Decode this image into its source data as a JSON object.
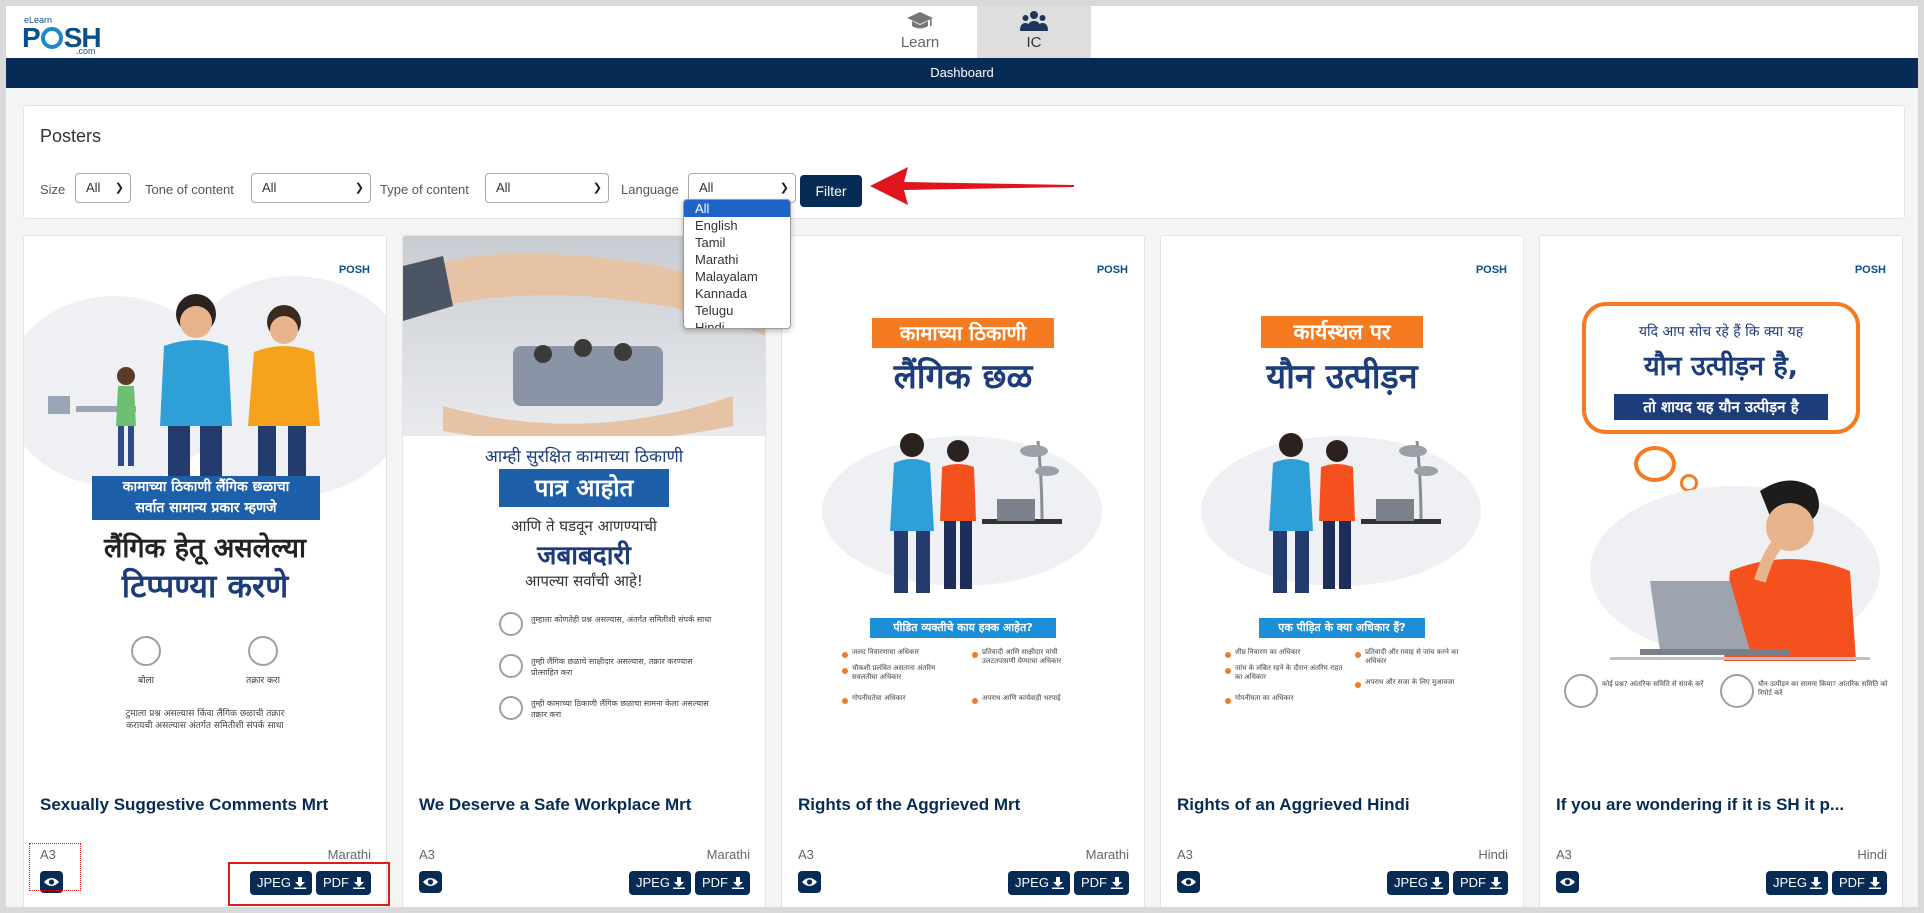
{
  "header": {
    "logo_small": "eLearn",
    "logo_big_a": "P",
    "logo_big_b": "SH",
    "logo_com": ".com",
    "tabs": [
      {
        "label": "Learn",
        "icon": "graduation-cap-icon"
      },
      {
        "label": "IC",
        "icon": "users-icon"
      }
    ],
    "nav_title": "Dashboard"
  },
  "filters": {
    "section_title": "Posters",
    "size_label": "Size",
    "size_value": "All",
    "tone_label": "Tone of content",
    "tone_value": "All",
    "type_label": "Type of content",
    "type_value": "All",
    "language_label": "Language",
    "language_value": "All",
    "filter_button": "Filter",
    "language_options": [
      "All",
      "English",
      "Tamil",
      "Marathi",
      "Malayalam",
      "Kannada",
      "Telugu",
      "Hindi"
    ]
  },
  "cards": [
    {
      "title": "Sexually Suggestive Comments Mrt",
      "size": "A3",
      "language": "Marathi",
      "jpeg_label": "JPEG",
      "pdf_label": "PDF",
      "poster": {
        "logo": "POSH",
        "box_line1": "कामाच्या ठिकाणी लैंगिक छळाचा",
        "box_line2": "सर्वात सामान्य प्रकार म्हणजे",
        "big1": "लैंगिक हेतू असलेल्या",
        "big2": "टिप्पण्या करणे",
        "icon1_label": "बोला",
        "icon2_label": "तक्रार करा",
        "foot1": "टुमाला प्रश्न असल्यास किंवा लैंगिक छळाची तक्रार",
        "foot2": "करायची असल्यास अंतर्गत समितीशी संपर्क साधा"
      }
    },
    {
      "title": "We Deserve a Safe Workplace Mrt",
      "size": "A3",
      "language": "Marathi",
      "jpeg_label": "JPEG",
      "pdf_label": "PDF",
      "poster": {
        "line1": "आम्ही सुरक्षित कामाच्या ठिकाणी",
        "box": "पात्र आहोत",
        "line2": "आणि ते घडवून आणण्याची",
        "big": "जबाबदारी",
        "line3": "आपल्या सर्वांची आहे!",
        "item1": "तुम्हाला कोणतेही प्रश्न असल्यास, अंतर्गत समितीशी संपर्क साधा",
        "item2": "तुम्ही लैंगिक छळाचे साक्षीदार असल्यास, तक्रार करण्यास प्रोत्साहित करा",
        "item3": "तुम्ही कामाच्या ठिकाणी लैंगिक छळाचा सामना केला असल्यास तक्रार करा"
      }
    },
    {
      "title": "Rights of the Aggrieved Mrt",
      "size": "A3",
      "language": "Marathi",
      "jpeg_label": "JPEG",
      "pdf_label": "PDF",
      "poster": {
        "logo": "POSH",
        "top": "कामाच्या ठिकाणी",
        "big": "लैंगिक छळ",
        "banner": "पीडित व्यक्तीचे काय हक्क आहेत?",
        "b1": "जलद निवारणाचा अधिकार",
        "b2": "चौकशी प्रलंबित असताना अंतरिम सवलतीचा अधिकार",
        "b3": "गोपनीयतेचा अधिकार",
        "b4": "प्रतिवादी आणि साक्षीदार यांची उलटतपासणी घेण्याचा अधिकार",
        "b5": "अपराध आणि कार्यवाही भरपाई"
      }
    },
    {
      "title": "Rights of an Aggrieved Hindi",
      "size": "A3",
      "language": "Hindi",
      "jpeg_label": "JPEG",
      "pdf_label": "PDF",
      "poster": {
        "logo": "POSH",
        "top": "कार्यस्थल पर",
        "big": "यौन उत्पीड़न",
        "banner": "एक पीड़ित के क्या अधिकार हैं?",
        "b1": "शीघ्र निवारण का अधिकार",
        "b2": "जांच के लंबित रहने के दौरान अंतरिम राहत का अधिकार",
        "b3": "गोपनीयता का अधिकार",
        "b4": "प्रतिवादी और गवाह से जांच करने का अधिकार",
        "b5": "अपराध और सजा के लिए मुआवजा"
      }
    },
    {
      "title": "If you are wondering if it is SH it p...",
      "size": "A3",
      "language": "Hindi",
      "jpeg_label": "JPEG",
      "pdf_label": "PDF",
      "poster": {
        "logo": "POSH",
        "line1": "यदि आप सोच रहे हैं कि क्या यह",
        "big": "यौन उत्पीड़न है,",
        "box": "तो शायद यह यौन उत्पीड़न है",
        "f1": "कोई प्रश्न? आंतरिक समिति से संपर्क करें",
        "f2": "यौन उत्पीड़न का सामना किया? आंतरिक समिति को रिपोर्ट करें"
      }
    }
  ],
  "colors": {
    "navy": "#062b54",
    "accent_orange": "#f47b20",
    "selection_blue": "#1e64c8",
    "annotation_red": "#e01b1b"
  }
}
